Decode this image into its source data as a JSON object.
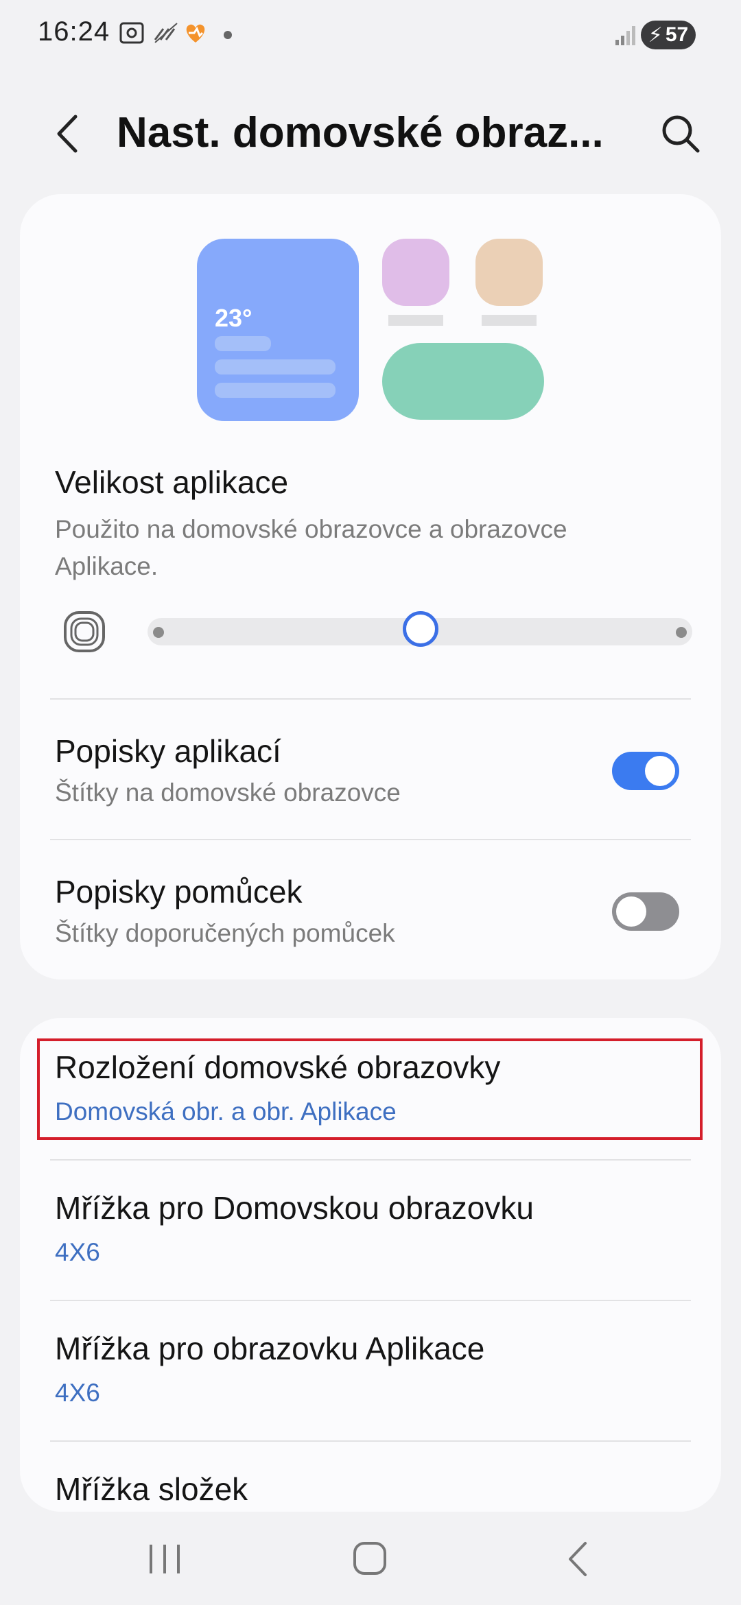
{
  "status_bar": {
    "time": "16:24",
    "battery": "57",
    "icons": [
      "screenshot-icon",
      "no-signal-icon",
      "health-app-icon",
      "notification-dot-icon",
      "signal-icon",
      "battery-charging-icon"
    ]
  },
  "header": {
    "title": "Nast. domovské obraz...",
    "back_icon": "back-arrow-icon",
    "search_icon": "search-icon"
  },
  "preview": {
    "temperature": "23°",
    "colors": {
      "weather": "#86a9fb",
      "pink_app": "#e0bde8",
      "peach_app": "#ebd0b6",
      "pill": "#86d1b8"
    }
  },
  "app_size": {
    "title": "Velikost aplikace",
    "subtitle": "Použito na domovské obrazovce a obrazovce Aplikace.",
    "slider_level": 0.5
  },
  "app_labels": {
    "title": "Popisky aplikací",
    "subtitle": "Štítky na domovské obrazovce",
    "enabled": true
  },
  "widget_labels": {
    "title": "Popisky pomůcek",
    "subtitle": "Štítky doporučených pomůcek",
    "enabled": false
  },
  "layout_items": [
    {
      "title": "Rozložení domovské obrazovky",
      "value": "Domovská obr. a obr. Aplikace",
      "highlighted": true
    },
    {
      "title": "Mřížka pro Domovskou obrazovku",
      "value": "4X6"
    },
    {
      "title": "Mřížka pro obrazovku Aplikace",
      "value": "4X6"
    },
    {
      "title": "Mřížka složek",
      "value": ""
    }
  ],
  "colors": {
    "accent": "#3b7bf0",
    "link": "#3e6fc1",
    "highlight": "#d41e2b"
  },
  "nav_bar": {
    "icons": [
      "recents-icon",
      "home-icon",
      "back-icon"
    ]
  }
}
